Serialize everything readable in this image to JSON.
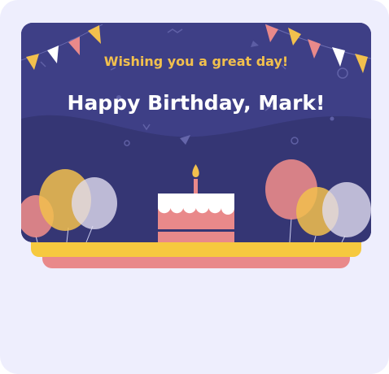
{
  "card": {
    "subtitle": "Wishing you a great day!",
    "title": "Happy Birthday, Mark!"
  },
  "colors": {
    "background": "#eeeefd",
    "card": "#3e3f86",
    "accent_yellow": "#f2c04d",
    "accent_pink": "#e9898a",
    "text": "#ffffff"
  },
  "icons": [
    "bunting-flags",
    "balloon",
    "birthday-cake",
    "candle"
  ]
}
